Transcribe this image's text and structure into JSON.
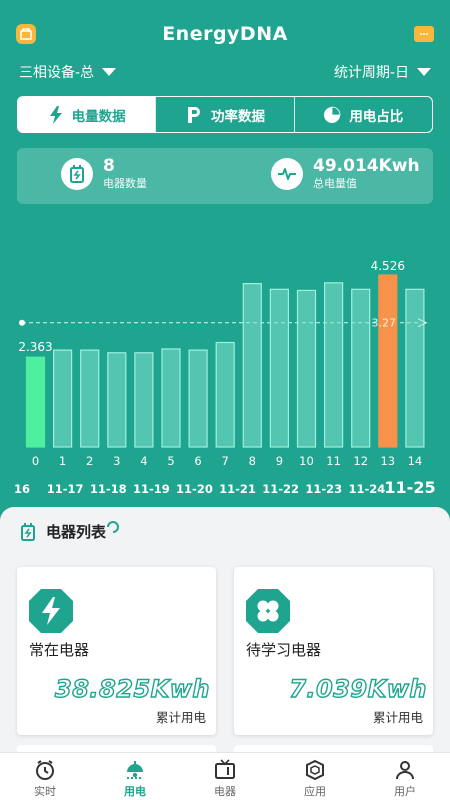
{
  "header": {
    "title": "EnergyDNA"
  },
  "selectors": {
    "device": "三相设备-总",
    "period": "统计周期-日"
  },
  "tabs": [
    {
      "label": "电量数据",
      "icon": "lightning-icon",
      "active": true
    },
    {
      "label": "功率数据",
      "icon": "power-p-icon",
      "active": false
    },
    {
      "label": "用电占比",
      "icon": "pie-chart-icon",
      "active": false
    }
  ],
  "stats": {
    "device_count": {
      "value": "8",
      "label": "电器数量"
    },
    "total_energy": {
      "value": "49.014Kwh",
      "label": "总电量值"
    }
  },
  "chart_data": {
    "type": "bar",
    "categories": [
      "0",
      "1",
      "2",
      "3",
      "4",
      "5",
      "6",
      "7",
      "8",
      "9",
      "10",
      "11",
      "12",
      "13",
      "14"
    ],
    "values": [
      2.363,
      2.55,
      2.55,
      2.48,
      2.48,
      2.58,
      2.55,
      2.75,
      4.3,
      4.15,
      4.12,
      4.32,
      4.15,
      4.526,
      4.15
    ],
    "date_labels": [
      "16",
      "11-17",
      "11-18",
      "11-19",
      "11-20",
      "11-21",
      "11-22",
      "11-23",
      "11-24",
      "11-25"
    ],
    "highlight_max_index": 13,
    "highlight_min_index": 0,
    "max_label": "4.526",
    "min_label": "2.363",
    "average": 3.27,
    "average_label": "3.27",
    "ylim": [
      0,
      5.0
    ],
    "colors": {
      "bar": "#7ee0cc",
      "min_bar": "#4ef0a0",
      "max_bar": "#f7924a"
    }
  },
  "panel": {
    "title": "电器列表",
    "cards": [
      {
        "name": "常在电器",
        "value": "38.825Kwh",
        "unit": "累计用电",
        "icon": "lightning-octagon-icon"
      },
      {
        "name": "待学习电器",
        "value": "7.039Kwh",
        "unit": "累计用电",
        "icon": "clover-octagon-icon"
      }
    ]
  },
  "tabbar": [
    {
      "label": "实时",
      "icon": "clock-icon",
      "active": false
    },
    {
      "label": "用电",
      "icon": "lamp-icon",
      "active": true
    },
    {
      "label": "电器",
      "icon": "tv-icon",
      "active": false
    },
    {
      "label": "应用",
      "icon": "cube-icon",
      "active": false
    },
    {
      "label": "用户",
      "icon": "user-icon",
      "active": false
    }
  ],
  "colors": {
    "primary": "#1fa58f",
    "accent": "#f6b73c",
    "max": "#f7924a",
    "min": "#4ef0a0"
  }
}
